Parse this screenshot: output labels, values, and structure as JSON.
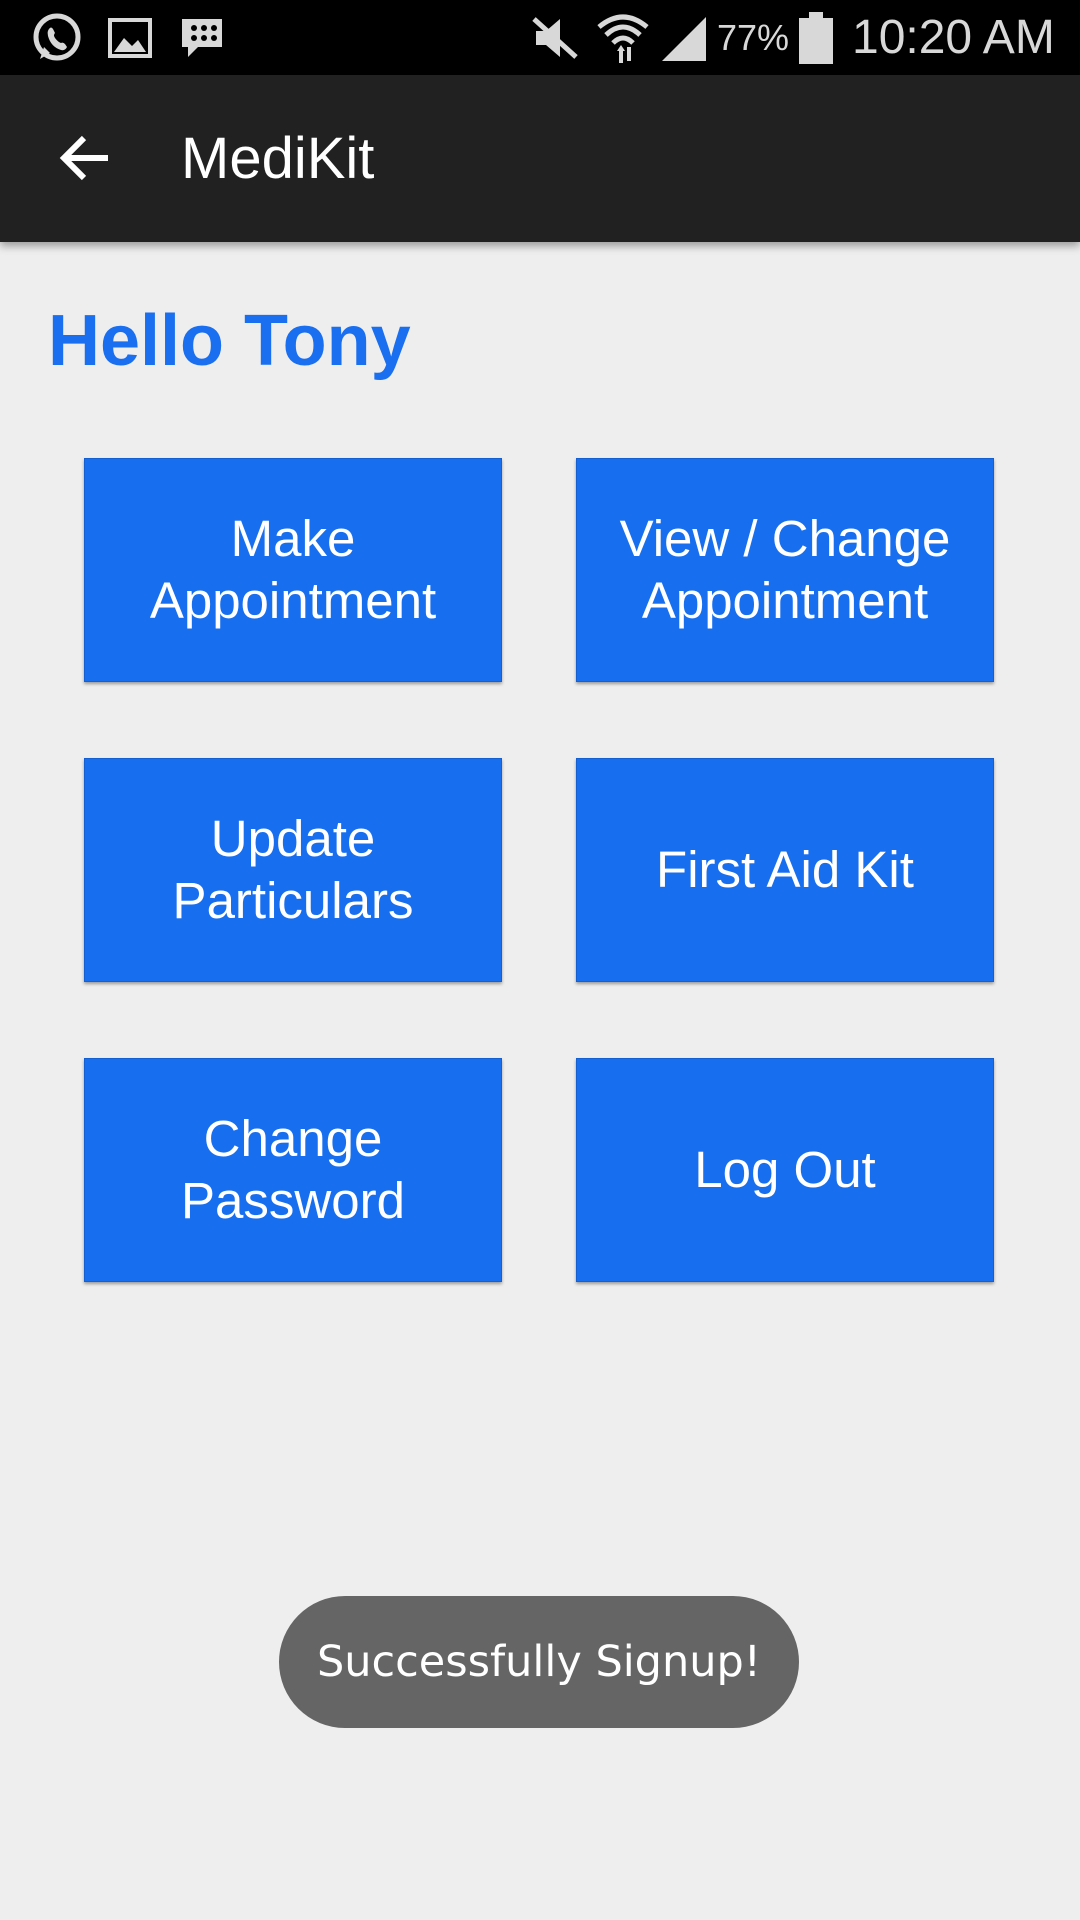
{
  "status_bar": {
    "icons": [
      "whatsapp-icon",
      "gallery-icon",
      "bbm-icon",
      "mute-icon",
      "wifi-icon",
      "signal-icon",
      "battery-icon"
    ],
    "battery": "77%",
    "time": "10:20 AM"
  },
  "app_bar": {
    "back_icon": "arrow-left-icon",
    "title": "MediKit"
  },
  "greeting": "Hello Tony",
  "buttons": [
    {
      "label": "Make\nAppointment"
    },
    {
      "label": "View / Change\nAppointment"
    },
    {
      "label": "Update\nParticulars"
    },
    {
      "label": "First Aid Kit"
    },
    {
      "label": "Change\nPassword"
    },
    {
      "label": "Log Out"
    }
  ],
  "toast": "Successfully Signup!",
  "colors": {
    "accent": "#176ff0",
    "greeting": "#1a6ff0",
    "app_bar": "#212121",
    "background": "#eeeeee",
    "toast": "#656565"
  }
}
